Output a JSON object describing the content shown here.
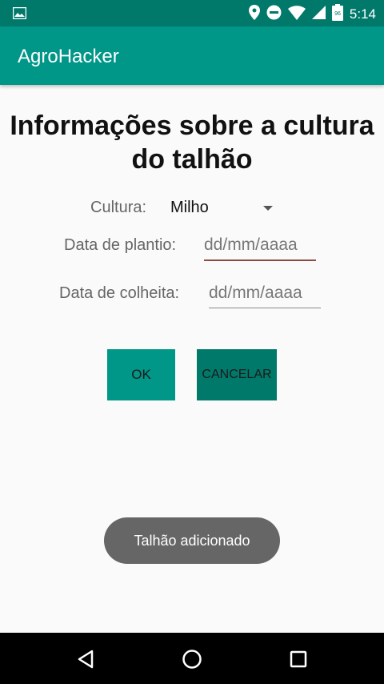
{
  "status_bar": {
    "time": "5:14",
    "battery_level": "96"
  },
  "app_bar": {
    "title": "AgroHacker"
  },
  "page": {
    "heading_line1": "Informações sobre a cultura",
    "heading_line2": "do talhão"
  },
  "form": {
    "cultura_label": "Cultura:",
    "cultura_value": "Milho",
    "plantio_label": "Data de plantio:",
    "plantio_placeholder": "dd/mm/aaaa",
    "colheita_label": "Data de colheita:",
    "colheita_placeholder": "dd/mm/aaaa"
  },
  "buttons": {
    "ok_label": "OK",
    "cancel_label": "CANCELAR"
  },
  "toast": {
    "message": "Talhão adicionado"
  },
  "colors": {
    "primary": "#009688",
    "primary_dark": "#00796b",
    "field_active_underline": "#8d4a3f"
  }
}
